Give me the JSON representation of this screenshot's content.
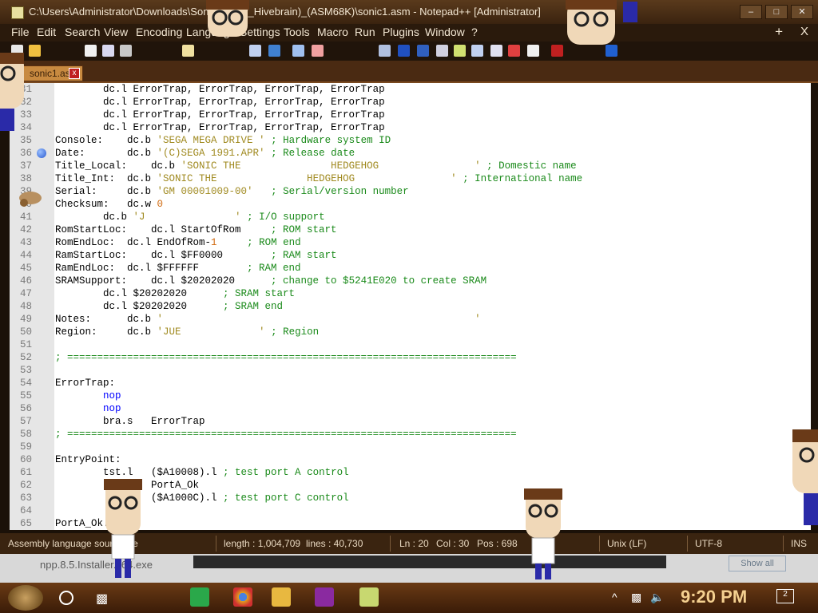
{
  "window": {
    "title": "C:\\Users\\Administrator\\Downloads\\Sonic_1_(by_Hivebrain)_(ASM68K)\\sonic1.asm - Notepad++ [Administrator]"
  },
  "menu": {
    "items": [
      "File",
      "Edit",
      "Search",
      "View",
      "Encoding",
      "Language",
      "Settings",
      "Tools",
      "Macro",
      "Run",
      "Plugins",
      "Window",
      "?"
    ],
    "new_tab_icon": "+",
    "close_icon": "X"
  },
  "tab": {
    "label": "sonic1.asm",
    "close": "x"
  },
  "editor": {
    "lines": [
      {
        "n": "31",
        "code": [
          {
            "t": "        dc.l ErrorTrap, ErrorTrap, ErrorTrap, ErrorTrap",
            "k": ""
          }
        ]
      },
      {
        "n": "32",
        "code": [
          {
            "t": "        dc.l ErrorTrap, ErrorTrap, ErrorTrap, ErrorTrap",
            "k": ""
          }
        ]
      },
      {
        "n": "33",
        "code": [
          {
            "t": "        dc.l ErrorTrap, ErrorTrap, ErrorTrap, ErrorTrap",
            "k": ""
          }
        ]
      },
      {
        "n": "34",
        "code": [
          {
            "t": "        dc.l ErrorTrap, ErrorTrap, ErrorTrap, ErrorTrap",
            "k": ""
          }
        ]
      },
      {
        "n": "35",
        "code": [
          {
            "t": "Console:    dc.b ",
            "k": ""
          },
          {
            "t": "'SEGA MEGA DRIVE '",
            "k": "s"
          },
          {
            "t": " ; Hardware system ID",
            "k": "c"
          }
        ]
      },
      {
        "n": "36",
        "code": [
          {
            "t": "Date:       dc.b ",
            "k": ""
          },
          {
            "t": "'(C)SEGA 1991.APR'",
            "k": "s"
          },
          {
            "t": " ; Release date",
            "k": "c"
          }
        ]
      },
      {
        "n": "37",
        "code": [
          {
            "t": "Title_Local:    dc.b ",
            "k": ""
          },
          {
            "t": "'SONIC THE               HEDGEHOG                '",
            "k": "s"
          },
          {
            "t": " ; Domestic name",
            "k": "c"
          }
        ]
      },
      {
        "n": "38",
        "code": [
          {
            "t": "Title_Int:  dc.b ",
            "k": ""
          },
          {
            "t": "'SONIC THE               HEDGEHOG                '",
            "k": "s"
          },
          {
            "t": " ; International name",
            "k": "c"
          }
        ]
      },
      {
        "n": "39",
        "code": [
          {
            "t": "Serial:     dc.b ",
            "k": ""
          },
          {
            "t": "'GM 00001009-00'",
            "k": "s"
          },
          {
            "t": "   ; Serial/version number",
            "k": "c"
          }
        ]
      },
      {
        "n": "40",
        "code": [
          {
            "t": "Checksum:   dc.w ",
            "k": ""
          },
          {
            "t": "0",
            "k": "n"
          }
        ]
      },
      {
        "n": "41",
        "code": [
          {
            "t": "        dc.b ",
            "k": ""
          },
          {
            "t": "'J               '",
            "k": "s"
          },
          {
            "t": " ; I/O support",
            "k": "c"
          }
        ]
      },
      {
        "n": "42",
        "code": [
          {
            "t": "RomStartLoc:    dc.l StartOfRom     ",
            "k": ""
          },
          {
            "t": "; ROM start",
            "k": "c"
          }
        ]
      },
      {
        "n": "43",
        "code": [
          {
            "t": "RomEndLoc:  dc.l EndOfRom-",
            "k": ""
          },
          {
            "t": "1",
            "k": "n"
          },
          {
            "t": "     ",
            "k": ""
          },
          {
            "t": "; ROM end",
            "k": "c"
          }
        ]
      },
      {
        "n": "44",
        "code": [
          {
            "t": "RamStartLoc:    dc.l $FF0000        ",
            "k": ""
          },
          {
            "t": "; RAM start",
            "k": "c"
          }
        ]
      },
      {
        "n": "45",
        "code": [
          {
            "t": "RamEndLoc:  dc.l $FFFFFF        ",
            "k": ""
          },
          {
            "t": "; RAM end",
            "k": "c"
          }
        ]
      },
      {
        "n": "46",
        "code": [
          {
            "t": "SRAMSupport:    dc.l $20202020      ",
            "k": ""
          },
          {
            "t": "; change to $5241E020 to create SRAM",
            "k": "c"
          }
        ]
      },
      {
        "n": "47",
        "code": [
          {
            "t": "        dc.l $20202020      ",
            "k": ""
          },
          {
            "t": "; SRAM start",
            "k": "c"
          }
        ]
      },
      {
        "n": "48",
        "code": [
          {
            "t": "        dc.l $20202020      ",
            "k": ""
          },
          {
            "t": "; SRAM end",
            "k": "c"
          }
        ]
      },
      {
        "n": "49",
        "code": [
          {
            "t": "Notes:      dc.b ",
            "k": ""
          },
          {
            "t": "'                                                    '",
            "k": "s"
          }
        ]
      },
      {
        "n": "50",
        "code": [
          {
            "t": "Region:     dc.b ",
            "k": ""
          },
          {
            "t": "'JUE             '",
            "k": "s"
          },
          {
            "t": " ; Region",
            "k": "c"
          }
        ]
      },
      {
        "n": "51",
        "code": []
      },
      {
        "n": "52",
        "code": [
          {
            "t": "; ===========================================================================",
            "k": "c"
          }
        ]
      },
      {
        "n": "53",
        "code": []
      },
      {
        "n": "54",
        "code": [
          {
            "t": "ErrorTrap:",
            "k": ""
          }
        ]
      },
      {
        "n": "55",
        "code": [
          {
            "t": "        nop",
            "k": "kw"
          }
        ]
      },
      {
        "n": "56",
        "code": [
          {
            "t": "        nop",
            "k": "kw"
          }
        ]
      },
      {
        "n": "57",
        "code": [
          {
            "t": "        bra.s   ErrorTrap",
            "k": ""
          }
        ]
      },
      {
        "n": "58",
        "code": [
          {
            "t": "; ===========================================================================",
            "k": "c"
          }
        ]
      },
      {
        "n": "59",
        "code": []
      },
      {
        "n": "60",
        "code": [
          {
            "t": "EntryPoint:",
            "k": ""
          }
        ]
      },
      {
        "n": "61",
        "code": [
          {
            "t": "        tst.l   ($A10008).l ",
            "k": ""
          },
          {
            "t": "; test port A control",
            "k": "c"
          }
        ]
      },
      {
        "n": "62",
        "code": [
          {
            "t": "                PortA_Ok",
            "k": ""
          }
        ]
      },
      {
        "n": "63",
        "code": [
          {
            "t": "                ($A1000C).l ",
            "k": ""
          },
          {
            "t": "; test port C control",
            "k": "c"
          }
        ]
      },
      {
        "n": "64",
        "code": []
      },
      {
        "n": "65",
        "code": [
          {
            "t": "PortA_Ok:",
            "k": ""
          }
        ]
      }
    ],
    "bookmark_line": "36"
  },
  "status": {
    "language": "Assembly language source file",
    "length": "length : 1,004,709",
    "lines": "lines : 40,730",
    "ln": "Ln : 20",
    "col": "Col : 30",
    "pos": "Pos : 698",
    "eol": "Unix (LF)",
    "encoding": "UTF-8",
    "mode": "INS"
  },
  "background_window": {
    "file": "npp.8.5.Installer.x64.exe",
    "button": "Show all"
  },
  "taskbar": {
    "time": "9:20 PM",
    "notifications": "2"
  }
}
